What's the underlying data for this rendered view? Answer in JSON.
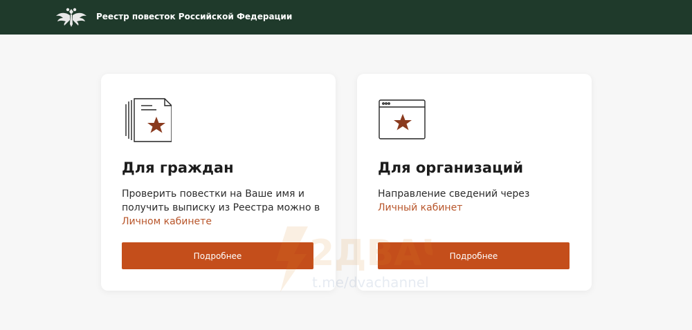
{
  "header": {
    "title": "Реестр повесток Российской Федерации",
    "emblem_icon": "double-headed-eagle-icon",
    "background_color": "#1f3a2b"
  },
  "cards": [
    {
      "title": "Для граждан",
      "icon": "documents-star-icon",
      "description_parts": [
        "Проверить повестки на Ваше имя и получить выписку из Реестра можно в ",
        "Личном кабинете"
      ],
      "button_label": "Подробнее"
    },
    {
      "title": "Для организаций",
      "icon": "browser-window-star-icon",
      "description_parts": [
        "Направление сведений через ",
        "Личный кабинет"
      ],
      "button_label": "Подробнее"
    }
  ],
  "watermark": {
    "logo_text": "2ДВАЧ",
    "channel": "t.me/dvachannel"
  },
  "colors": {
    "accent": "#c44e1b",
    "link": "#b8562b",
    "star": "#8a3a1e",
    "page_background": "#f7f7f7"
  }
}
